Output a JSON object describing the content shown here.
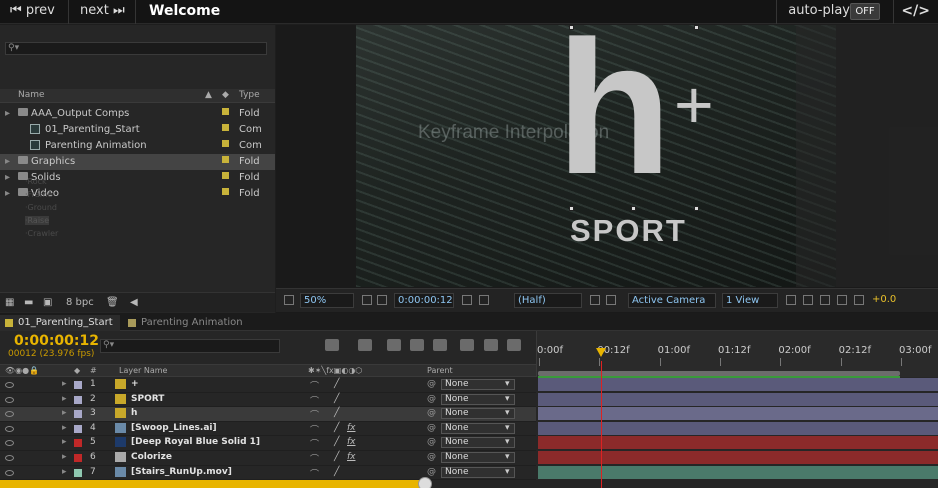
{
  "player": {
    "prev_label": "prev",
    "next_label": "next",
    "title": "Welcome",
    "autoplay_label": "auto-play",
    "autoplay_state": "OFF",
    "embed_label": "</>"
  },
  "project": {
    "columns": {
      "name": "Name",
      "type": "Type"
    },
    "rows": [
      {
        "label": "AAA_Output Comps",
        "type": "Fold",
        "kind": "folder"
      },
      {
        "label": "01_Parenting_Start",
        "type": "Com",
        "kind": "comp"
      },
      {
        "label": "Parenting Animation",
        "type": "Com",
        "kind": "comp"
      },
      {
        "label": "Graphics",
        "type": "Fold",
        "kind": "folder"
      },
      {
        "label": "Solids",
        "type": "Fold",
        "kind": "folder"
      },
      {
        "label": "Video",
        "type": "Fold",
        "kind": "folder"
      }
    ],
    "bpc": "8 bpc"
  },
  "viewer": {
    "overlay_title": "Keyframe Interpolation",
    "logo_letter": "h",
    "logo_plus": "+",
    "logo_word": "SPORT",
    "zoom": "50%",
    "timecode": "0:00:00:12",
    "resolution": "(Half)",
    "camera": "Active Camera",
    "views": "1 View",
    "exposure": "+0.0"
  },
  "timeline": {
    "tabs": [
      "01_Parenting_Start",
      "Parenting Animation"
    ],
    "timecode": "0:00:00:12",
    "fps": "00012 (23.976 fps)",
    "col_layer_name": "Layer Name",
    "col_parent": "Parent",
    "col_hash": "#",
    "ruler_ticks": [
      "0:00f",
      "00:12f",
      "01:00f",
      "01:12f",
      "02:00f",
      "02:12f",
      "03:00f"
    ],
    "layers": [
      {
        "num": "1",
        "name": "+",
        "parent": "None",
        "color": "#a8a8c8",
        "bar": "#5a5a7a",
        "fx": ""
      },
      {
        "num": "2",
        "name": "SPORT",
        "parent": "None",
        "color": "#a8a8c8",
        "bar": "#5a5a7a",
        "fx": ""
      },
      {
        "num": "3",
        "name": "h",
        "parent": "None",
        "color": "#a8a8c8",
        "bar": "#6a6a8a",
        "fx": ""
      },
      {
        "num": "4",
        "name": "[Swoop_Lines.ai]",
        "parent": "None",
        "color": "#a8a8c8",
        "bar": "#5a5a7a",
        "fx": "fx"
      },
      {
        "num": "5",
        "name": "[Deep Royal Blue Solid 1]",
        "parent": "None",
        "color": "#c02828",
        "bar": "#8c2a2a",
        "fx": "fx"
      },
      {
        "num": "6",
        "name": "Colorize",
        "parent": "None",
        "color": "#c02828",
        "bar": "#8c2a2a",
        "fx": "fx"
      },
      {
        "num": "7",
        "name": "[Stairs_RunUp.mov]",
        "parent": "None",
        "color": "#8fc8b0",
        "bar": "#4a7a6a",
        "fx": ""
      }
    ]
  },
  "colors": {
    "accent": "#e8b400",
    "playhead": "#dd2222",
    "label_yellow": "#c8b33a"
  }
}
